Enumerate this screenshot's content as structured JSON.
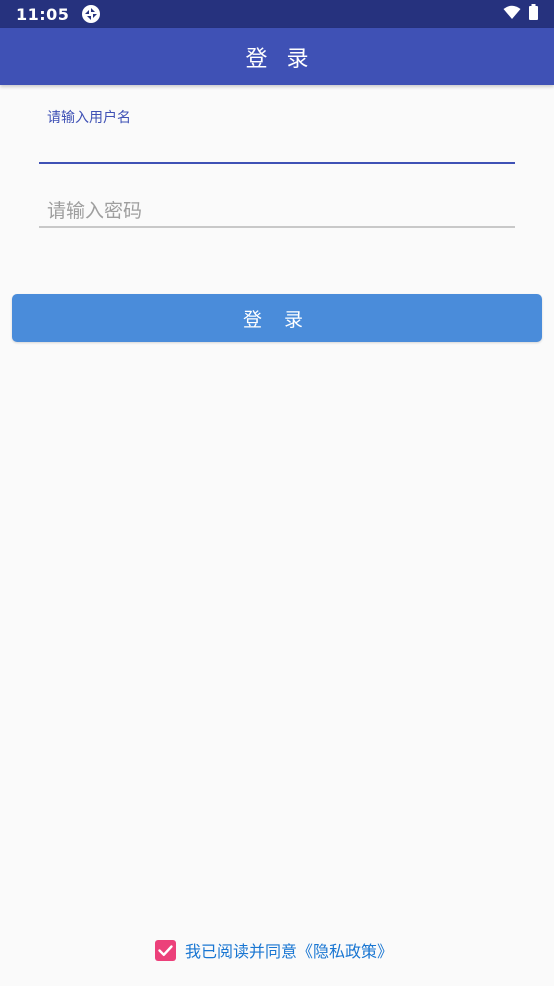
{
  "status_bar": {
    "time": "11:05"
  },
  "app_bar": {
    "title": "登 录"
  },
  "form": {
    "username": {
      "label": "请输入用户名",
      "value": ""
    },
    "password": {
      "placeholder": "请输入密码",
      "value": ""
    },
    "login_button": "登 录"
  },
  "agreement": {
    "checked": true,
    "text": "我已阅读并同意《隐私政策》"
  },
  "colors": {
    "status_bar": "#26327e",
    "primary": "#3f51b5",
    "button": "#4a8cda",
    "checkbox": "#ec407a",
    "link": "#1976d2"
  },
  "icons": [
    "app-sync-icon",
    "wifi-icon",
    "battery-icon",
    "check-icon"
  ]
}
